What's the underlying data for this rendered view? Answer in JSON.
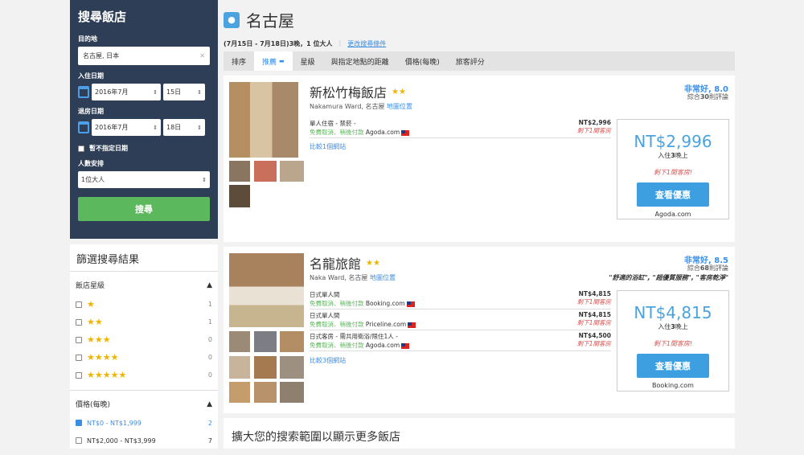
{
  "search_panel": {
    "title": "搜尋飯店",
    "dest_label": "目的地",
    "dest_value": "名古屋, 日本",
    "checkin_label": "入住日期",
    "checkin_month": "2016年7月",
    "checkin_day": "15日",
    "checkout_label": "退房日期",
    "checkout_month": "2016年7月",
    "checkout_day": "18日",
    "no_date_label": "暫不指定日期",
    "guests_label": "人數安排",
    "guests_value": "1位大人",
    "search_button": "搜尋"
  },
  "filter": {
    "title": "篩選搜尋結果",
    "stars_title": "飯店星級",
    "stars": [
      {
        "icons": "★",
        "count": "1"
      },
      {
        "icons": "★★",
        "count": "1"
      },
      {
        "icons": "★★★",
        "count": "0"
      },
      {
        "icons": "★★★★",
        "count": "0"
      },
      {
        "icons": "★★★★★",
        "count": "0"
      }
    ],
    "price_title": "價格(每晚)",
    "prices": [
      {
        "label": "NT$0 - NT$1,999",
        "count": "2",
        "checked": true
      },
      {
        "label": "NT$2,000 - NT$3,999",
        "count": "7",
        "checked": false
      }
    ]
  },
  "header": {
    "city": "名古屋",
    "summary": "(7月15日 - 7月18日)3晚，1 位大人",
    "change_link": "更改搜尋條件"
  },
  "tabs": [
    "排序",
    "推薦",
    "星級",
    "與指定地點的距離",
    "價格(每晚)",
    "旅客評分"
  ],
  "hotels": [
    {
      "name": "新松竹梅飯店",
      "address": "Nakamura Ward, 名古屋",
      "map": "地圖位置",
      "rating": "非常好, 8.0",
      "reviews_pre": "綜合",
      "reviews_n": "30",
      "reviews_post": "則評論",
      "quote": "",
      "offers": [
        {
          "room": "單人住宿 - 禁菸 -",
          "terms": "免費取消、稍後付款",
          "site": "Agoda.com",
          "price": "NT$2,996",
          "left": "剩下1間客房"
        }
      ],
      "compare": "比較1個網站",
      "best_price": "NT$2,996",
      "per_night_pre": "入住",
      "per_night_n": "3",
      "per_night_post": "晚上",
      "left": "剩下1間客房!",
      "deal": "查看優惠",
      "best_site": "Agoda.com"
    },
    {
      "name": "名龍旅館",
      "address": "Naka Ward, 名古屋",
      "map": "地圖位置",
      "rating": "非常好, 8.5",
      "reviews_pre": "綜合",
      "reviews_n": "68",
      "reviews_post": "則評論",
      "quote": "\"舒適的浴缸\", \"超優質服務\", \"客房乾淨\"",
      "offers": [
        {
          "room": "日式單人間",
          "terms": "免費取消、稍後付款",
          "site": "Booking.com",
          "price": "NT$4,815",
          "left": "剩下1間客房"
        },
        {
          "room": "日式單人間",
          "terms": "免費取消、稍後付款",
          "site": "Priceline.com",
          "price": "NT$4,815",
          "left": "剩下1間客房"
        },
        {
          "room": "日式客房 - 需共用衛浴/限住1人 -",
          "terms": "免費取消、稍後付款",
          "site": "Agoda.com",
          "price": "NT$4,500",
          "left": "剩下1間客房"
        }
      ],
      "compare": "比較3個網站",
      "best_price": "NT$4,815",
      "per_night_pre": "入住",
      "per_night_n": "3",
      "per_night_post": "晚上",
      "left": "剩下1間客房!",
      "deal": "查看優惠",
      "best_site": "Booking.com"
    }
  ],
  "expand": {
    "title": "擴大您的搜索範圍以顯示更多飯店"
  }
}
